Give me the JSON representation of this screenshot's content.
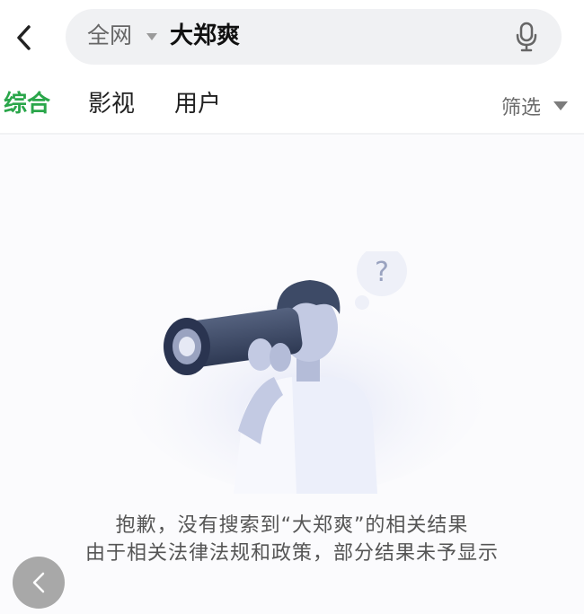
{
  "search": {
    "scope": "全网",
    "query": "大郑爽"
  },
  "tabs": [
    {
      "label": "综合",
      "active": true
    },
    {
      "label": "影视",
      "active": false
    },
    {
      "label": "用户",
      "active": false
    }
  ],
  "filter": {
    "label": "筛选"
  },
  "empty_state": {
    "question_mark": "?",
    "line1": "抱歉，没有搜索到“大郑爽”的相关结果",
    "line2": "由于相关法律法规和政策，部分结果未予显示"
  },
  "colors": {
    "accent": "#2aa64a",
    "search_bg": "#f0f1f3",
    "illustration": "#3d4a66"
  },
  "icons": [
    "back-arrow-icon",
    "dropdown-caret-icon",
    "microphone-icon",
    "filter-caret-icon",
    "floating-back-icon"
  ]
}
